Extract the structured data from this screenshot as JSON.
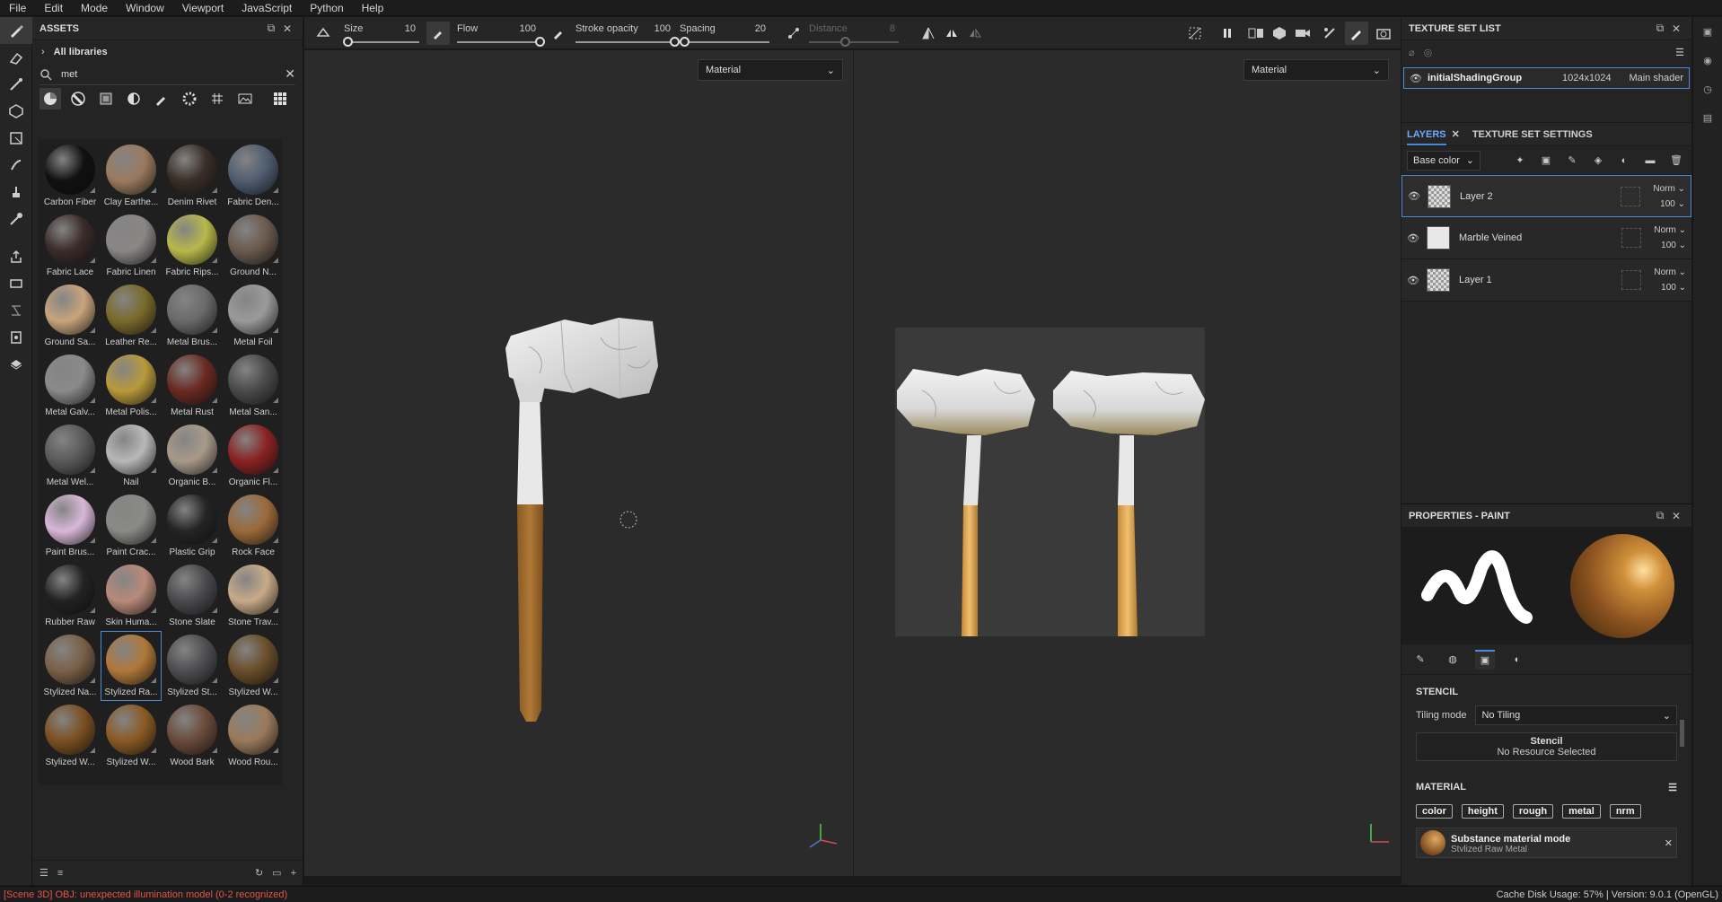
{
  "menu": [
    "File",
    "Edit",
    "Mode",
    "Window",
    "Viewport",
    "JavaScript",
    "Python",
    "Help"
  ],
  "assets": {
    "title": "ASSETS",
    "library": "All libraries",
    "search_value": "met",
    "items": [
      {
        "name": "Carbon Fiber",
        "color": "#111111"
      },
      {
        "name": "Clay Earthe...",
        "color": "#9a7a5e"
      },
      {
        "name": "Denim Rivet",
        "color": "#3a2e28"
      },
      {
        "name": "Fabric Den...",
        "color": "#4f5d70"
      },
      {
        "name": "Fabric Lace",
        "color": "#3a2c2a"
      },
      {
        "name": "Fabric Linen",
        "color": "#8a8684"
      },
      {
        "name": "Fabric Rips...",
        "color": "#b8b84a"
      },
      {
        "name": "Ground N...",
        "color": "#6a5a4e"
      },
      {
        "name": "Ground Sa...",
        "color": "#c8a47c"
      },
      {
        "name": "Leather Re...",
        "color": "#7a6a2a"
      },
      {
        "name": "Metal Brus...",
        "color": "#6a6a6a"
      },
      {
        "name": "Metal Foil",
        "color": "#9a9a9a"
      },
      {
        "name": "Metal Galv...",
        "color": "#8a8a8a"
      },
      {
        "name": "Metal Polis...",
        "color": "#b89a3a"
      },
      {
        "name": "Metal Rust",
        "color": "#6a2a22"
      },
      {
        "name": "Metal San...",
        "color": "#4a4a4a"
      },
      {
        "name": "Metal Wel...",
        "color": "#5a5a5a"
      },
      {
        "name": "Nail",
        "color": "#b8b8b8"
      },
      {
        "name": "Organic B...",
        "color": "#a89a8a"
      },
      {
        "name": "Organic Fl...",
        "color": "#8a2222"
      },
      {
        "name": "Paint Brus...",
        "color": "#d8b8d8"
      },
      {
        "name": "Paint Crac...",
        "color": "#8a8a86"
      },
      {
        "name": "Plastic Grip",
        "color": "#252525"
      },
      {
        "name": "Rock Face",
        "color": "#9a6a3a"
      },
      {
        "name": "Rubber Raw",
        "color": "#222222"
      },
      {
        "name": "Skin Huma...",
        "color": "#b88a7a"
      },
      {
        "name": "Stone Slate",
        "color": "#4a4a4e"
      },
      {
        "name": "Stone Trav...",
        "color": "#c8aa88"
      },
      {
        "name": "Stylized Na...",
        "color": "#7a6048"
      },
      {
        "name": "Stylized Ra...",
        "color": "#b0783a"
      },
      {
        "name": "Stylized St...",
        "color": "#4e4e52"
      },
      {
        "name": "Stylized W...",
        "color": "#6a4e2a"
      },
      {
        "name": "Stylized W...",
        "color": "#7a5020"
      },
      {
        "name": "Stylized W...",
        "color": "#8a5a24"
      },
      {
        "name": "Wood Bark",
        "color": "#6a4a3a"
      },
      {
        "name": "Wood Rou...",
        "color": "#9a7a5a"
      }
    ],
    "selected_index": 29
  },
  "toolbar": {
    "size_label": "Size",
    "size_value": "10",
    "size_frac": 0.05,
    "flow_label": "Flow",
    "flow_value": "100",
    "flow_frac": 1.0,
    "opacity_label": "Stroke opacity",
    "opacity_value": "100",
    "opacity_frac": 1.0,
    "spacing_label": "Spacing",
    "spacing_value": "20",
    "spacing_frac": 0.05,
    "distance_label": "Distance",
    "distance_value": "8",
    "distance_frac": 0.4
  },
  "viewports": {
    "left_mode": "Material",
    "right_mode": "Material"
  },
  "texture_set": {
    "title": "TEXTURE SET LIST",
    "name": "initialShadingGroup",
    "resolution": "1024x1024",
    "shader": "Main shader"
  },
  "layers": {
    "tab_layers": "LAYERS",
    "tab_settings": "TEXTURE SET SETTINGS",
    "channel": "Base color",
    "items": [
      {
        "name": "Layer 2",
        "blend": "Norm",
        "opacity": "100"
      },
      {
        "name": "Marble Veined",
        "blend": "Norm",
        "opacity": "100"
      },
      {
        "name": "Layer 1",
        "blend": "Norm",
        "opacity": "100"
      }
    ]
  },
  "properties": {
    "title": "PROPERTIES - PAINT",
    "stencil_title": "STENCIL",
    "tiling_label": "Tiling mode",
    "tiling_value": "No Tiling",
    "stencil_label": "Stencil",
    "stencil_value": "No Resource Selected",
    "material_title": "MATERIAL",
    "channels": [
      "color",
      "height",
      "rough",
      "metal",
      "nrm"
    ],
    "submat_title": "Substance material mode",
    "submat_value": "Stylized Raw Metal"
  },
  "status": {
    "error": "[Scene 3D] OBJ: unexpected illumination model (0-2 recognized)",
    "disk": "Cache Disk Usage:   57% | Version: 9.0.1 (OpenGL)"
  }
}
